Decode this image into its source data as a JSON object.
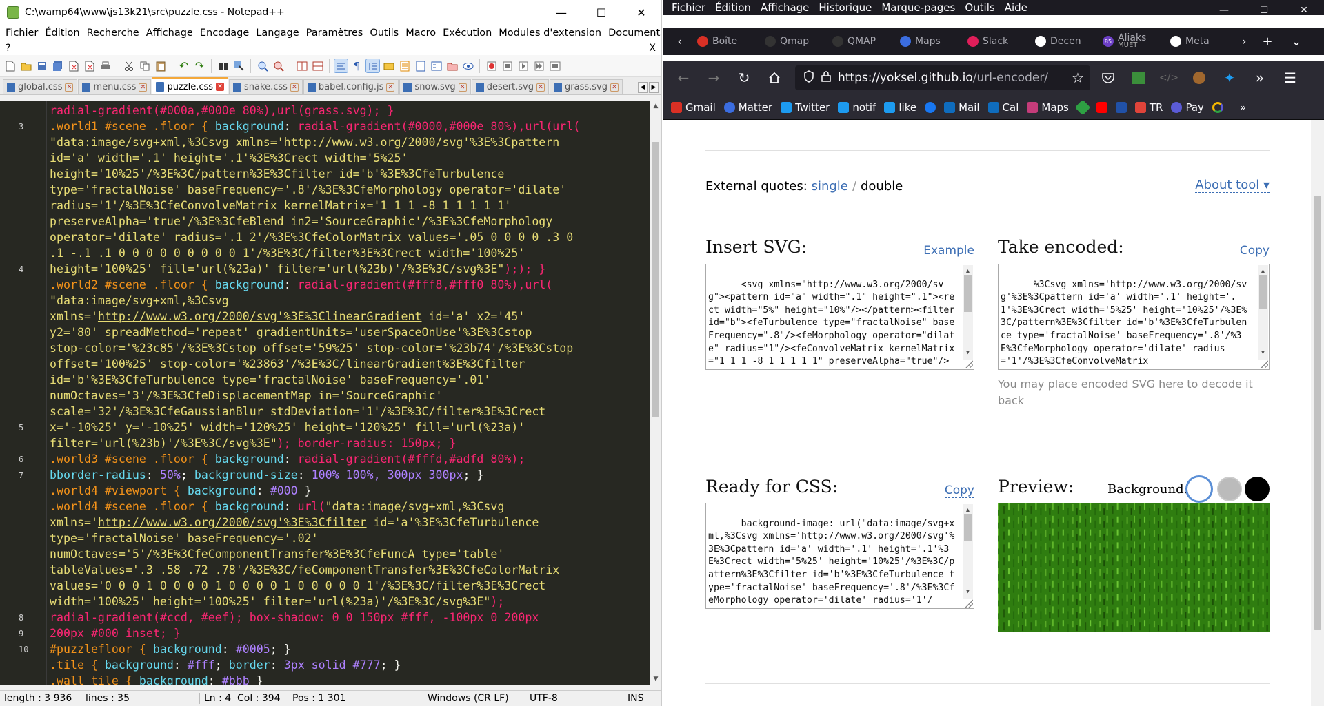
{
  "notepad": {
    "title": "C:\\wamp64\\www\\js13k21\\src\\puzzle.css - Notepad++",
    "menu": [
      "Fichier",
      "Édition",
      "Recherche",
      "Affichage",
      "Encodage",
      "Langage",
      "Paramètres",
      "Outils",
      "Macro",
      "Exécution",
      "Modules d'extension",
      "Documents"
    ],
    "menu2_left": "?",
    "menu2_right": "X",
    "tabs": [
      "global.css",
      "menu.css",
      "puzzle.css",
      "snake.css",
      "babel.config.js",
      "snow.svg",
      "desert.svg",
      "grass.svg"
    ],
    "active_tab": 2,
    "gutter": [
      "",
      "3",
      "",
      "",
      "",
      "",
      "",
      "",
      "",
      "",
      "4",
      "",
      "",
      "",
      "",
      "",
      "",
      "",
      "",
      "",
      "5",
      "",
      "6",
      "7",
      "",
      "",
      "",
      "",
      "",
      "",
      "",
      "",
      "8",
      "9",
      "10"
    ],
    "code": [
      [
        [
          "s-pink",
          "radial-gradient(#000a,#000e 80%),url(grass.svg); }"
        ]
      ],
      [
        [
          "s-sel",
          ".world1 #scene .floor { "
        ],
        [
          "s-prop",
          "background"
        ],
        [
          "",
          "："
        ],
        [
          "s-pink",
          "radial-gradient(#0000,#000e 80%),url(url("
        ]
      ],
      [
        [
          "s-str",
          "\"data:image/svg+xml,%3Csvg xmlns='"
        ],
        [
          "s-str s-url",
          "http://www.w3.org/2000/svg'%3E%3Cpattern"
        ]
      ],
      [
        [
          "s-str",
          "id='a' width='.1' height='.1'%3E%3Crect width='5%25'"
        ]
      ],
      [
        [
          "s-str",
          "height='10%25'/%3E%3C/pattern%3E%3Cfilter id='b'%3E%3CfeTurbulence"
        ]
      ],
      [
        [
          "s-str",
          "type='fractalNoise' baseFrequency='.8'/%3E%3CfeMorphology operator='dilate'"
        ]
      ],
      [
        [
          "s-str",
          "radius='1'/%3E%3CfeConvolveMatrix kernelMatrix='1 1 1 -8 1 1 1 1 1'"
        ]
      ],
      [
        [
          "s-str",
          "preserveAlpha='true'/%3E%3CfeBlend in2='SourceGraphic'/%3E%3CfeMorphology"
        ]
      ],
      [
        [
          "s-str",
          "operator='dilate' radius='.1 2'/%3E%3CfeColorMatrix values='.05 0 0 0 0 .3 0"
        ]
      ],
      [
        [
          "s-str",
          ".1 -.1 .1 0 0 0 0 0 0 0 0 0 1'/%3E%3C/filter%3E%3Crect width='100%25'"
        ]
      ],
      [
        [
          "s-str",
          "height='100%25' fill='url(%23a)' filter='url(%23b)'/%3E%3C/svg%3E\""
        ],
        [
          "s-pink",
          ");); }"
        ]
      ],
      [
        [
          "s-sel",
          ".world2 #scene .floor { "
        ],
        [
          "s-prop",
          "background"
        ],
        [
          "",
          "："
        ],
        [
          "s-pink",
          "radial-gradient(#fff8,#fff0 80%),url("
        ]
      ],
      [
        [
          "s-str",
          "\"data:image/svg+xml,%3Csvg"
        ]
      ],
      [
        [
          "s-str",
          "xmlns='"
        ],
        [
          "s-str s-url",
          "http://www.w3.org/2000/svg'%3E%3ClinearGradient"
        ],
        [
          "s-str",
          " id='a' x2='45'"
        ]
      ],
      [
        [
          "s-str",
          "y2='80' spreadMethod='repeat' gradientUnits='userSpaceOnUse'%3E%3Cstop"
        ]
      ],
      [
        [
          "s-str",
          "stop-color='%23c85'/%3E%3Cstop offset='59%25' stop-color='%23b74'/%3E%3Cstop"
        ]
      ],
      [
        [
          "s-str",
          "offset='100%25' stop-color='%23863'/%3E%3C/linearGradient%3E%3Cfilter"
        ]
      ],
      [
        [
          "s-str",
          "id='b'%3E%3CfeTurbulence type='fractalNoise' baseFrequency='.01'"
        ]
      ],
      [
        [
          "s-str",
          "numOctaves='3'/%3E%3CfeDisplacementMap in='SourceGraphic'"
        ]
      ],
      [
        [
          "s-str",
          "scale='32'/%3E%3CfeGaussianBlur stdDeviation='1'/%3E%3C/filter%3E%3Crect"
        ]
      ],
      [
        [
          "s-str",
          "x='-10%25' y='-10%25' width='120%25' height='120%25' fill='url(%23a)'"
        ]
      ],
      [
        [
          "s-str",
          "filter='url(%23b)'/%3E%3C/svg%3E\""
        ],
        [
          "s-pink",
          "); border-radius: 150px; }"
        ]
      ],
      [
        [
          "s-sel",
          ".world3 #scene .floor { "
        ],
        [
          "s-prop",
          "background"
        ],
        [
          "",
          "："
        ],
        [
          "s-pink",
          "radial-gradient(#fffd,#adfd 80%);"
        ]
      ],
      [
        [
          "s-prop",
          "bborder-radius"
        ],
        [
          "",
          "："
        ],
        [
          "s-num",
          "50%"
        ],
        [
          "",
          ";"
        ],
        [
          "s-prop",
          " background-size"
        ],
        [
          "",
          "："
        ],
        [
          "s-num",
          "100% 100%, 300px 300px"
        ],
        [
          "",
          "; }"
        ]
      ],
      [
        [
          "s-sel",
          ".world4 #viewport { "
        ],
        [
          "s-prop",
          "background"
        ],
        [
          "",
          "："
        ],
        [
          "s-num",
          "#000"
        ],
        [
          "",
          " }"
        ]
      ],
      [
        [
          "s-sel",
          ".world4 #scene .floor { "
        ],
        [
          "s-prop",
          "background"
        ],
        [
          "",
          "："
        ],
        [
          "s-pink",
          "url("
        ],
        [
          "s-str",
          "\"data:image/svg+xml,%3Csvg"
        ]
      ],
      [
        [
          "s-str",
          "xmlns='"
        ],
        [
          "s-str s-url",
          "http://www.w3.org/2000/svg'%3E%3Cfilter"
        ],
        [
          "s-str",
          " id='a'%3E%3CfeTurbulence"
        ]
      ],
      [
        [
          "s-str",
          "type='fractalNoise' baseFrequency='.02'"
        ]
      ],
      [
        [
          "s-str",
          "numOctaves='5'/%3E%3CfeComponentTransfer%3E%3CfeFuncA type='table'"
        ]
      ],
      [
        [
          "s-str",
          "tableValues='.3 .58 .72 .78'/%3E%3C/feComponentTransfer%3E%3CfeColorMatrix"
        ]
      ],
      [
        [
          "s-str",
          "values='0 0 0 1 0 0 0 0 1 0 0 0 0 1 0 0 0 0 0 1'/%3E%3C/filter%3E%3Crect"
        ]
      ],
      [
        [
          "s-str",
          "width='100%25' height='100%25' filter='url(%23a)'/%3E%3C/svg%3E\""
        ],
        [
          "s-pink",
          ");"
        ]
      ],
      [
        [
          "s-pink",
          "radial-gradient(#ccd, #eef); box-shadow: 0 0 150px #fff, -100px 0 200px"
        ]
      ],
      [
        [
          "s-pink",
          "200px #000 inset; }"
        ]
      ],
      [
        [
          "s-sel",
          "#puzzlefloor { "
        ],
        [
          "s-prop",
          "background"
        ],
        [
          "",
          "："
        ],
        [
          "s-num",
          "#0005"
        ],
        [
          "",
          "; }"
        ]
      ],
      [
        [
          "s-sel",
          ".tile { "
        ],
        [
          "s-prop",
          "background"
        ],
        [
          "",
          "："
        ],
        [
          "s-num",
          "#fff"
        ],
        [
          "",
          "; "
        ],
        [
          "s-prop",
          "border"
        ],
        [
          "",
          "："
        ],
        [
          "s-num",
          "3px solid #777"
        ],
        [
          "",
          "; }"
        ]
      ],
      [
        [
          "s-sel",
          ".wall tile { "
        ],
        [
          "s-prop",
          "background"
        ],
        [
          "",
          "："
        ],
        [
          "s-num",
          "#bbb"
        ],
        [
          "",
          " }"
        ]
      ]
    ],
    "status": [
      "length : 3 936",
      "lines : 35",
      "Ln : 4",
      "Col : 394",
      "Pos : 1 301",
      "Windows (CR LF)",
      "UTF-8",
      "INS"
    ]
  },
  "firefox": {
    "menu": [
      "Fichier",
      "Édition",
      "Affichage",
      "Historique",
      "Marque-pages",
      "Outils",
      "Aide"
    ],
    "tabs": [
      {
        "label": "Boîte",
        "color": "#d93025"
      },
      {
        "label": "Qmap",
        "color": "#444"
      },
      {
        "label": "QMAP",
        "color": "#444"
      },
      {
        "label": "Maps",
        "color": "#3b6de0"
      },
      {
        "label": "Slack",
        "color": "#e01e5a"
      },
      {
        "label": "Decen",
        "color": "#fff"
      },
      {
        "label": "Aliaks",
        "sub": "MUET",
        "badge": "85",
        "color": "#6c3fc6"
      },
      {
        "label": "Meta",
        "color": "#fff"
      }
    ],
    "url_host": "https://yoksel.github.io",
    "url_path": "/url-encoder/",
    "bookmarks": [
      {
        "label": "Gmail",
        "color": "#d93025"
      },
      {
        "label": "Matter",
        "color": "#3b6de0"
      },
      {
        "label": "Twitter",
        "color": "#1d9bf0"
      },
      {
        "label": "notif",
        "color": "#1d9bf0"
      },
      {
        "label": "like",
        "color": "#1d9bf0"
      },
      {
        "label": "",
        "color": "#1877f2"
      },
      {
        "label": "Mail",
        "color": "#0f6cbd"
      },
      {
        "label": "Cal",
        "color": "#0f6cbd"
      },
      {
        "label": "Maps",
        "color": "#c53c7a"
      },
      {
        "label": "",
        "color": "#2ea043"
      },
      {
        "label": "",
        "color": "#ff0000"
      },
      {
        "label": "",
        "color": "#2151a8"
      },
      {
        "label": "TR",
        "color": "#e0443a"
      },
      {
        "label": "Pay",
        "color": "#5b5bd6"
      },
      {
        "label": "",
        "color": "#f5b800"
      }
    ]
  },
  "page": {
    "quotes_label": "External quotes:",
    "quotes_single": "single",
    "quotes_sep": "/",
    "quotes_double": "double",
    "about": "About tool ▾",
    "insert_title": "Insert SVG:",
    "insert_action": "Example",
    "insert_text": "<svg xmlns=\"http://www.w3.org/2000/svg\"><pattern id=\"a\" width=\".1\" height=\".1\"><rect width=\"5%\" height=\"10%\"/></pattern><filter id=\"b\"><feTurbulence type=\"fractalNoise\" baseFrequency=\".8\"/><feMorphology operator=\"dilate\" radius=\"1\"/><feConvolveMatrix kernelMatrix=\"1 1 1 -8 1 1 1 1 1\" preserveAlpha=\"true\"/>",
    "take_title": "Take encoded:",
    "take_action": "Copy",
    "take_text": "%3Csvg xmlns='http://www.w3.org/2000/svg'%3E%3Cpattern id='a' width='.1' height='.1'%3E%3Crect width='5%25' height='10%25'/%3E%3C/pattern%3E%3Cfilter id='b'%3E%3CfeTurbulence type='fractalNoise' baseFrequency='.8'/%3E%3CfeMorphology operator='dilate' radius='1'/%3E%3CfeConvolveMatrix",
    "hint": "You may place encoded SVG here to decode it back",
    "css_title": "Ready for CSS:",
    "css_action": "Copy",
    "css_text": "background-image: url(\"data:image/svg+xml,%3Csvg xmlns='http://www.w3.org/2000/svg'%3E%3Cpattern id='a' width='.1' height='.1'%3E%3Crect width='5%25' height='10%25'/%3E%3C/pattern%3E%3Cfilter id='b'%3E%3CfeTurbulence type='fractalNoise' baseFrequency='.8'/%3E%3CfeMorphology operator='dilate' radius='1'/",
    "preview_title": "Preview:",
    "bg_label": "Background:"
  }
}
